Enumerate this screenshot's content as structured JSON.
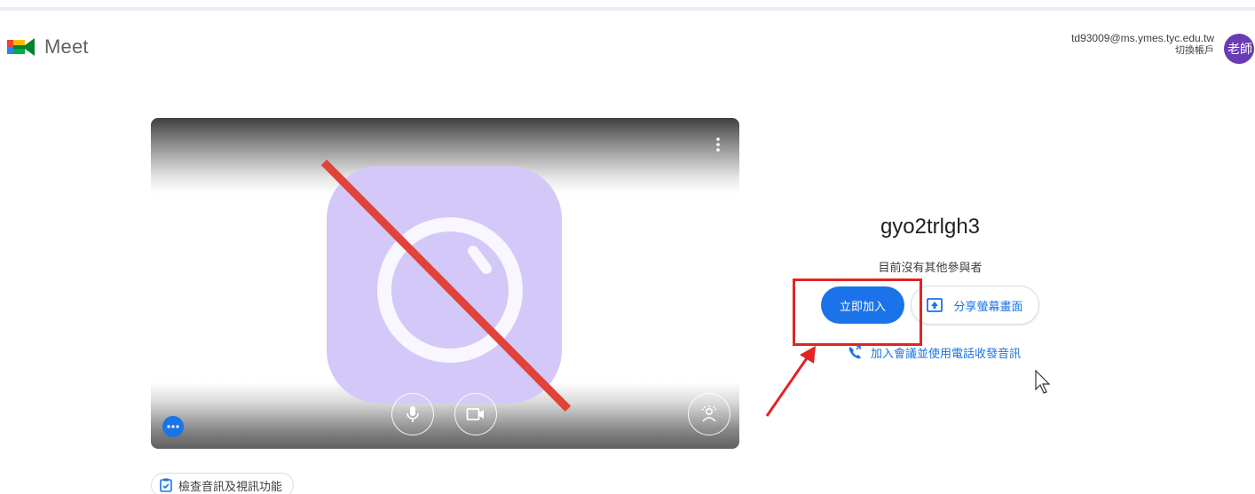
{
  "app": {
    "name": "Meet"
  },
  "account": {
    "email": "td93009@ms.ymes.tyc.edu.tw",
    "switch_label": "切換帳戶",
    "avatar_text": "老師",
    "avatar_color": "#6a3bb5"
  },
  "preview": {
    "more_options_icon": "more-vert-icon",
    "mic_icon": "microphone-icon",
    "camera_icon": "camera-icon",
    "effects_icon": "visual-effects-icon",
    "dots_icon": "more-horiz-icon",
    "placeholder_icon": "camera-off-icon"
  },
  "check": {
    "label": "檢查音訊及視訊功能"
  },
  "meeting": {
    "code": "gyo2trlgh3",
    "status": "目前沒有其他參與者",
    "join_label": "立即加入",
    "share_label": "分享螢幕畫面",
    "phone_label": "加入會議並使用電話收發音訊"
  },
  "colors": {
    "accent": "#1a73e8",
    "annotation": "#e02424"
  }
}
